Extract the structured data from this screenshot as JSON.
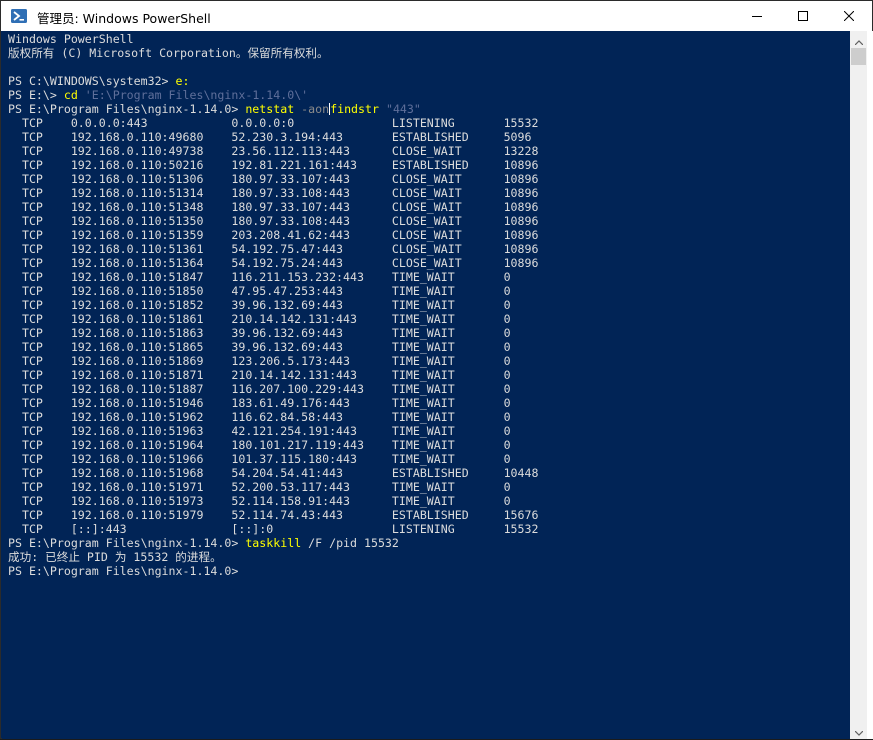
{
  "window": {
    "title": "管理员: Windows PowerShell",
    "controls": {
      "minimize": "minimize",
      "maximize": "maximize",
      "close": "close"
    }
  },
  "console": {
    "lines": [
      [
        {
          "t": "Windows PowerShell",
          "c": "plain"
        }
      ],
      [
        {
          "t": "版权所有 (C) Microsoft Corporation。保留所有权利。",
          "c": "plain"
        }
      ],
      [
        {
          "t": "",
          "c": "plain"
        }
      ],
      [
        {
          "t": "PS C:\\WINDOWS\\system32> ",
          "c": "plain"
        },
        {
          "t": "e:",
          "c": "cmd"
        }
      ],
      [
        {
          "t": "PS E:\\> ",
          "c": "plain"
        },
        {
          "t": "cd",
          "c": "cmd"
        },
        {
          "t": " 'E:\\Program Files\\nginx-1.14.0\\'",
          "c": "str"
        }
      ],
      [
        {
          "t": "PS E:\\Program Files\\nginx-1.14.0> ",
          "c": "plain"
        },
        {
          "t": "netstat",
          "c": "cmd"
        },
        {
          "t": " -aon",
          "c": "param"
        },
        {
          "t": "|",
          "c": "caret"
        },
        {
          "t": "findstr",
          "c": "cmd"
        },
        {
          "t": " \"443\"",
          "c": "str"
        }
      ],
      [
        {
          "t": "  TCP    0.0.0.0:443            0.0.0.0:0              LISTENING       15532",
          "c": "plain"
        }
      ],
      [
        {
          "t": "  TCP    192.168.0.110:49680    52.230.3.194:443       ESTABLISHED     5096",
          "c": "plain"
        }
      ],
      [
        {
          "t": "  TCP    192.168.0.110:49738    23.56.112.113:443      CLOSE_WAIT      13228",
          "c": "plain"
        }
      ],
      [
        {
          "t": "  TCP    192.168.0.110:50216    192.81.221.161:443     ESTABLISHED     10896",
          "c": "plain"
        }
      ],
      [
        {
          "t": "  TCP    192.168.0.110:51306    180.97.33.107:443      CLOSE_WAIT      10896",
          "c": "plain"
        }
      ],
      [
        {
          "t": "  TCP    192.168.0.110:51314    180.97.33.108:443      CLOSE_WAIT      10896",
          "c": "plain"
        }
      ],
      [
        {
          "t": "  TCP    192.168.0.110:51348    180.97.33.107:443      CLOSE_WAIT      10896",
          "c": "plain"
        }
      ],
      [
        {
          "t": "  TCP    192.168.0.110:51350    180.97.33.108:443      CLOSE_WAIT      10896",
          "c": "plain"
        }
      ],
      [
        {
          "t": "  TCP    192.168.0.110:51359    203.208.41.62:443      CLOSE_WAIT      10896",
          "c": "plain"
        }
      ],
      [
        {
          "t": "  TCP    192.168.0.110:51361    54.192.75.47:443       CLOSE_WAIT      10896",
          "c": "plain"
        }
      ],
      [
        {
          "t": "  TCP    192.168.0.110:51364    54.192.75.24:443       CLOSE_WAIT      10896",
          "c": "plain"
        }
      ],
      [
        {
          "t": "  TCP    192.168.0.110:51847    116.211.153.232:443    TIME_WAIT       0",
          "c": "plain"
        }
      ],
      [
        {
          "t": "  TCP    192.168.0.110:51850    47.95.47.253:443       TIME_WAIT       0",
          "c": "plain"
        }
      ],
      [
        {
          "t": "  TCP    192.168.0.110:51852    39.96.132.69:443       TIME_WAIT       0",
          "c": "plain"
        }
      ],
      [
        {
          "t": "  TCP    192.168.0.110:51861    210.14.142.131:443     TIME_WAIT       0",
          "c": "plain"
        }
      ],
      [
        {
          "t": "  TCP    192.168.0.110:51863    39.96.132.69:443       TIME_WAIT       0",
          "c": "plain"
        }
      ],
      [
        {
          "t": "  TCP    192.168.0.110:51865    39.96.132.69:443       TIME_WAIT       0",
          "c": "plain"
        }
      ],
      [
        {
          "t": "  TCP    192.168.0.110:51869    123.206.5.173:443      TIME_WAIT       0",
          "c": "plain"
        }
      ],
      [
        {
          "t": "  TCP    192.168.0.110:51871    210.14.142.131:443     TIME_WAIT       0",
          "c": "plain"
        }
      ],
      [
        {
          "t": "  TCP    192.168.0.110:51887    116.207.100.229:443    TIME_WAIT       0",
          "c": "plain"
        }
      ],
      [
        {
          "t": "  TCP    192.168.0.110:51946    183.61.49.176:443      TIME_WAIT       0",
          "c": "plain"
        }
      ],
      [
        {
          "t": "  TCP    192.168.0.110:51962    116.62.84.58:443       TIME_WAIT       0",
          "c": "plain"
        }
      ],
      [
        {
          "t": "  TCP    192.168.0.110:51963    42.121.254.191:443     TIME_WAIT       0",
          "c": "plain"
        }
      ],
      [
        {
          "t": "  TCP    192.168.0.110:51964    180.101.217.119:443    TIME_WAIT       0",
          "c": "plain"
        }
      ],
      [
        {
          "t": "  TCP    192.168.0.110:51966    101.37.115.180:443     TIME_WAIT       0",
          "c": "plain"
        }
      ],
      [
        {
          "t": "  TCP    192.168.0.110:51968    54.204.54.41:443       ESTABLISHED     10448",
          "c": "plain"
        }
      ],
      [
        {
          "t": "  TCP    192.168.0.110:51971    52.200.53.117:443      TIME_WAIT       0",
          "c": "plain"
        }
      ],
      [
        {
          "t": "  TCP    192.168.0.110:51973    52.114.158.91:443      TIME_WAIT       0",
          "c": "plain"
        }
      ],
      [
        {
          "t": "  TCP    192.168.0.110:51979    52.114.74.43:443       ESTABLISHED     15676",
          "c": "plain"
        }
      ],
      [
        {
          "t": "  TCP    [::]:443               [::]:0                 LISTENING       15532",
          "c": "plain"
        }
      ],
      [
        {
          "t": "PS E:\\Program Files\\nginx-1.14.0> ",
          "c": "plain"
        },
        {
          "t": "taskkill",
          "c": "cmd"
        },
        {
          "t": " /F /pid 15532",
          "c": "plain"
        }
      ],
      [
        {
          "t": "成功: 已终止 PID 为 15532 的进程。",
          "c": "plain"
        }
      ],
      [
        {
          "t": "PS E:\\Program Files\\nginx-1.14.0>",
          "c": "plain"
        }
      ]
    ]
  },
  "colors": {
    "console_background": "#012456",
    "console_text": "#dcdcdc",
    "command": "#ffff00",
    "parameter": "#8a8a8a",
    "string": "#5f6f9a"
  },
  "icons": {
    "app": "powershell-icon",
    "scroll_up": "chevron-up-icon",
    "scroll_down": "chevron-down-icon"
  }
}
